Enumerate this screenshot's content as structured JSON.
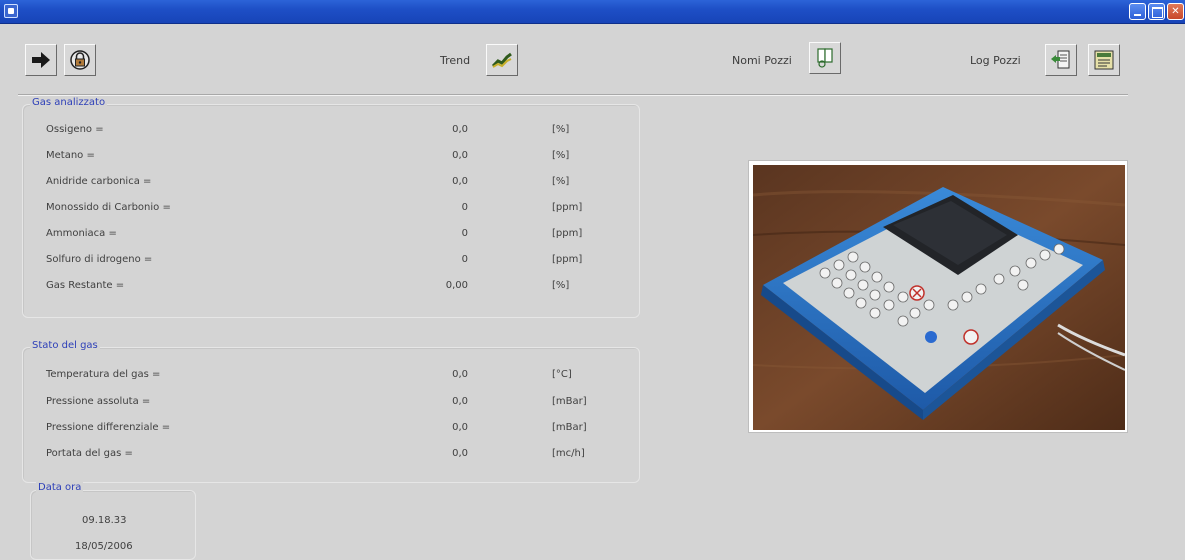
{
  "toolbar": {
    "trend_label": "Trend",
    "nomi_pozzi_label": "Nomi Pozzi",
    "log_pozzi_label": "Log Pozzi"
  },
  "gas_analizzato": {
    "title": "Gas analizzato",
    "rows": [
      {
        "label": "Ossigeno =",
        "value": "0,0",
        "unit": "[%]"
      },
      {
        "label": "Metano =",
        "value": "0,0",
        "unit": "[%]"
      },
      {
        "label": "Anidride carbonica =",
        "value": "0,0",
        "unit": "[%]"
      },
      {
        "label": "Monossido di Carbonio =",
        "value": "0",
        "unit": "[ppm]"
      },
      {
        "label": "Ammoniaca =",
        "value": "0",
        "unit": "[ppm]"
      },
      {
        "label": "Solfuro di idrogeno =",
        "value": "0",
        "unit": "[ppm]"
      },
      {
        "label": "Gas Restante =",
        "value": "0,00",
        "unit": "[%]"
      }
    ]
  },
  "stato_gas": {
    "title": "Stato del gas",
    "rows": [
      {
        "label": "Temperatura del gas =",
        "value": "0,0",
        "unit": "[°C]"
      },
      {
        "label": "Pressione assoluta =",
        "value": "0,0",
        "unit": "[mBar]"
      },
      {
        "label": "Pressione differenziale =",
        "value": "0,0",
        "unit": "[mBar]"
      },
      {
        "label": "Portata del gas =",
        "value": "0,0",
        "unit": "[mc/h]"
      }
    ]
  },
  "data_ora": {
    "title": "Data ora",
    "time": "09.18.33",
    "date": "18/05/2006"
  },
  "colors": {
    "titlebar": "#1e4fc6",
    "background": "#d4d4d4",
    "group_title": "#2d3fb8"
  },
  "icons": [
    "arrow-right-icon",
    "lock-icon",
    "trend-chart-icon",
    "book-icon",
    "log-export-icon",
    "log-list-icon"
  ]
}
